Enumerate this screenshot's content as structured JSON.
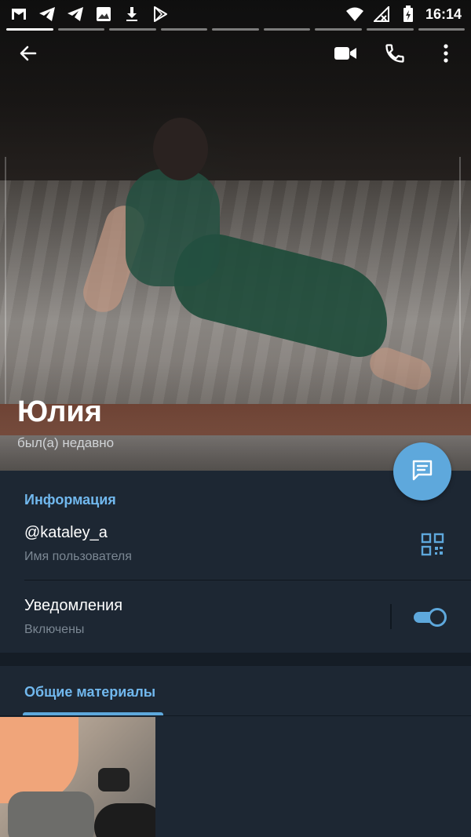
{
  "status_bar": {
    "time": "16:14",
    "left_icons": [
      "gmail-icon",
      "telegram-icon",
      "telegram-icon",
      "gallery-icon",
      "download-icon",
      "play-store-icon"
    ],
    "right_icons": [
      "wifi-icon",
      "no-signal-icon",
      "battery-icon"
    ]
  },
  "story_progress": {
    "segments": 9,
    "active_index": 0
  },
  "app_bar": {
    "back_icon": "arrow-left-icon",
    "actions": [
      "video-call-icon",
      "phone-icon",
      "more-vertical-icon"
    ]
  },
  "profile": {
    "name": "Юлия",
    "status": "был(а) недавно"
  },
  "info": {
    "section_title": "Информация",
    "username": {
      "value": "@kataley_a",
      "label": "Имя пользователя"
    },
    "notifications": {
      "title": "Уведомления",
      "value": "Включены",
      "enabled": true
    }
  },
  "shared_media": {
    "tab_label": "Общие материалы"
  },
  "colors": {
    "accent": "#5ea8dc",
    "section_title": "#71b8ee",
    "background": "#1d2733",
    "subtext": "#7b8793"
  }
}
